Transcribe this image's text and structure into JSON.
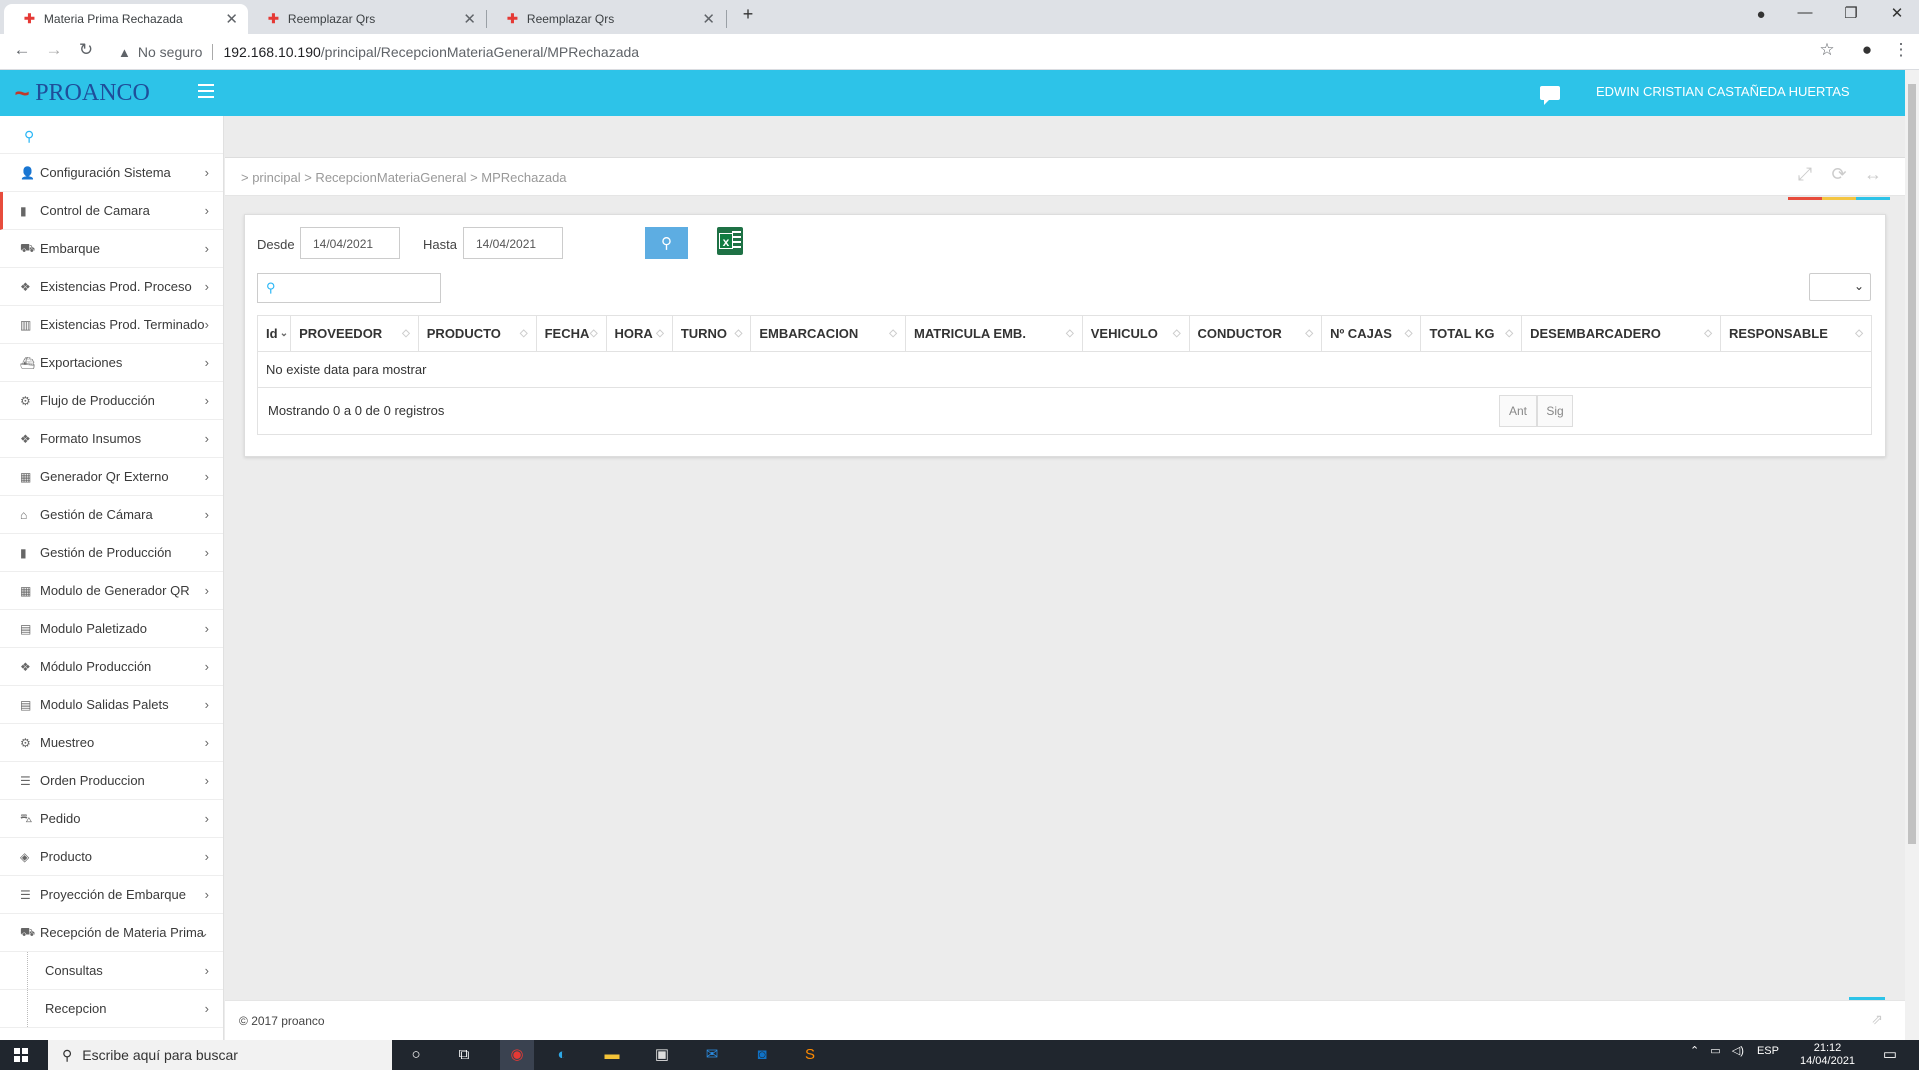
{
  "browser": {
    "tabs": [
      {
        "title": "Materia Prima Rechazada",
        "active": true
      },
      {
        "title": "Reemplazar Qrs",
        "active": false
      },
      {
        "title": "Reemplazar Qrs",
        "active": false
      }
    ],
    "security_label": "No seguro",
    "url_host": "192.168.10.190",
    "url_path": "/principal/RecepcionMateriaGeneral/MPRechazada"
  },
  "header": {
    "brand": "PROANCO",
    "user_name": "EDWIN CRISTIAN CASTAÑEDA HUERTAS",
    "accent_color": "#2dc3e8"
  },
  "sidebar": {
    "items": [
      {
        "label": "Configuración Sistema",
        "icon": "user-icon"
      },
      {
        "label": "Control de Camara",
        "icon": "bar-chart-icon"
      },
      {
        "label": "Embarque",
        "icon": "truck-icon"
      },
      {
        "label": "Existencias Prod. Proceso",
        "icon": "cubes-icon"
      },
      {
        "label": "Existencias Prod. Terminado",
        "icon": "building-icon"
      },
      {
        "label": "Exportaciones",
        "icon": "ship-icon"
      },
      {
        "label": "Flujo de Producción",
        "icon": "cogs-icon"
      },
      {
        "label": "Formato Insumos",
        "icon": "cubes-icon"
      },
      {
        "label": "Generador Qr Externo",
        "icon": "qrcode-icon"
      },
      {
        "label": "Gestión de Cámara",
        "icon": "bank-icon"
      },
      {
        "label": "Gestión de Producción",
        "icon": "bar-chart-icon"
      },
      {
        "label": "Modulo de Generador QR",
        "icon": "qrcode-icon"
      },
      {
        "label": "Modulo Paletizado",
        "icon": "calendar-icon"
      },
      {
        "label": "Módulo Producción",
        "icon": "cubes-icon"
      },
      {
        "label": "Modulo Salidas Palets",
        "icon": "calendar-icon"
      },
      {
        "label": "Muestreo",
        "icon": "cogs-icon"
      },
      {
        "label": "Orden Produccion",
        "icon": "sliders-icon"
      },
      {
        "label": "Pedido",
        "icon": "cart-icon"
      },
      {
        "label": "Producto",
        "icon": "cube-icon"
      },
      {
        "label": "Proyección de Embarque",
        "icon": "sliders-icon"
      },
      {
        "label": "Recepción de Materia Prima",
        "icon": "truck-icon"
      }
    ],
    "subitems": [
      {
        "label": "Consultas"
      },
      {
        "label": "Recepcion"
      }
    ]
  },
  "breadcrumb": "> principal > RecepcionMateriaGeneral > MPRechazada",
  "filters": {
    "desde_label": "Desde",
    "desde_value": "14/04/2021",
    "hasta_label": "Hasta",
    "hasta_value": "14/04/2021"
  },
  "table": {
    "columns": [
      "Id",
      "PROVEEDOR",
      "PRODUCTO",
      "FECHA",
      "HORA",
      "TURNO",
      "EMBARCACION",
      "MATRICULA EMB.",
      "VEHICULO",
      "CONDUCTOR",
      "Nº CAJAS",
      "TOTAL KG",
      "DESEMBARCADERO",
      "RESPONSABLE"
    ],
    "empty_message": "No existe data para mostrar",
    "info": "Mostrando 0 a 0 de 0 registros",
    "prev_label": "Ant",
    "next_label": "Sig"
  },
  "footer": {
    "copyright": "2017 proanco"
  },
  "taskbar": {
    "search_placeholder": "Escribe aquí para buscar",
    "language": "ESP",
    "time": "21:12",
    "date": "14/04/2021"
  }
}
